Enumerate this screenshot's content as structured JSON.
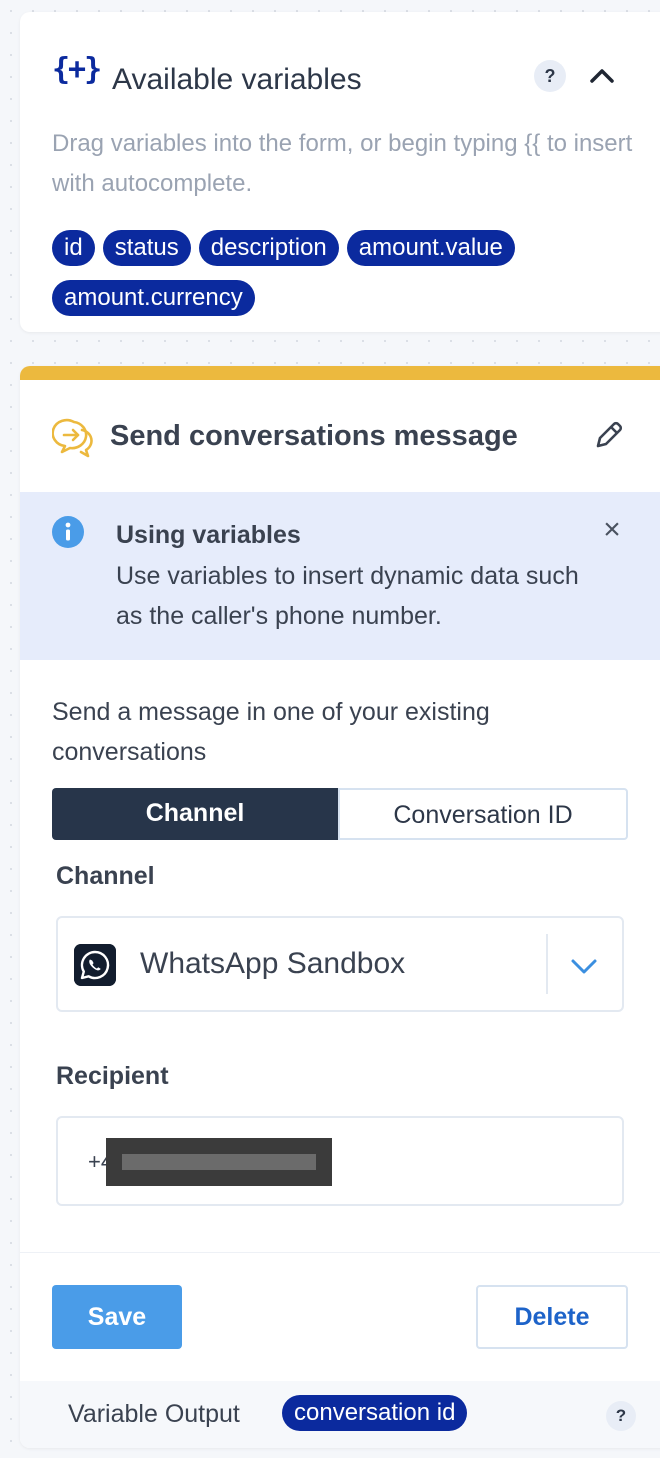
{
  "variables_panel": {
    "icon": "braces-plus-icon",
    "icon_glyph": "{+}",
    "title": "Available variables",
    "help_label": "?",
    "collapse_icon": "chevron-up-icon",
    "hint": "Drag variables into the form, or begin typing {{ to insert with autocomplete.",
    "chips": [
      "id",
      "status",
      "description",
      "amount.value",
      "amount.currency"
    ]
  },
  "action": {
    "accent_color": "#ecb93e",
    "icon": "conversation-arrow-icon",
    "title": "Send conversations message",
    "edit_icon": "pencil-icon",
    "info": {
      "icon": "info-icon",
      "title": "Using variables",
      "text": "Use variables to insert dynamic data such as the caller's phone number.",
      "close_label": "×"
    },
    "description": "Send a message in one of your existing conversations",
    "tabs": [
      {
        "label": "Channel",
        "active": true
      },
      {
        "label": "Conversation ID",
        "active": false
      }
    ],
    "channel": {
      "label": "Channel",
      "icon": "whatsapp-icon",
      "value": "WhatsApp Sandbox",
      "dropdown_icon": "chevron-down-icon"
    },
    "recipient": {
      "label": "Recipient",
      "value_prefix": "+4",
      "redacted": true
    },
    "buttons": {
      "save_label": "Save",
      "delete_label": "Delete"
    },
    "output": {
      "label": "Variable Output",
      "chip": "conversation id",
      "help_label": "?"
    }
  },
  "colors": {
    "chip": "#0b2a9e",
    "primary_button": "#4a9ce8",
    "tab_active": "#27354a",
    "info_bg": "#e6ecfb"
  }
}
